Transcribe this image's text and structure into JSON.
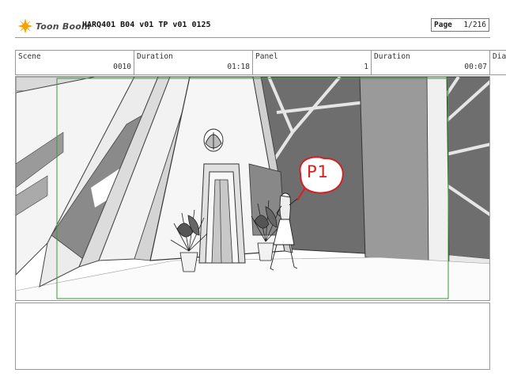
{
  "header": {
    "logo_text": "Toon Boom",
    "doc_title": "HARQ401 B04 v01 TP v01 0125",
    "page_label": "Page",
    "page_value": "1/216"
  },
  "info": {
    "scene_label": "Scene",
    "scene_value": "0010",
    "duration1_label": "Duration",
    "duration1_value": "01:18",
    "panel_label": "Panel",
    "panel_value": "1",
    "duration2_label": "Duration",
    "duration2_value": "00:07",
    "dialogue_label": "Dia"
  },
  "panel": {
    "callout_text": "P1",
    "camera_frame_color": "#3a9a3a",
    "callout_color": "#d42020"
  },
  "icons": [
    "toon-boom-logo-icon"
  ]
}
